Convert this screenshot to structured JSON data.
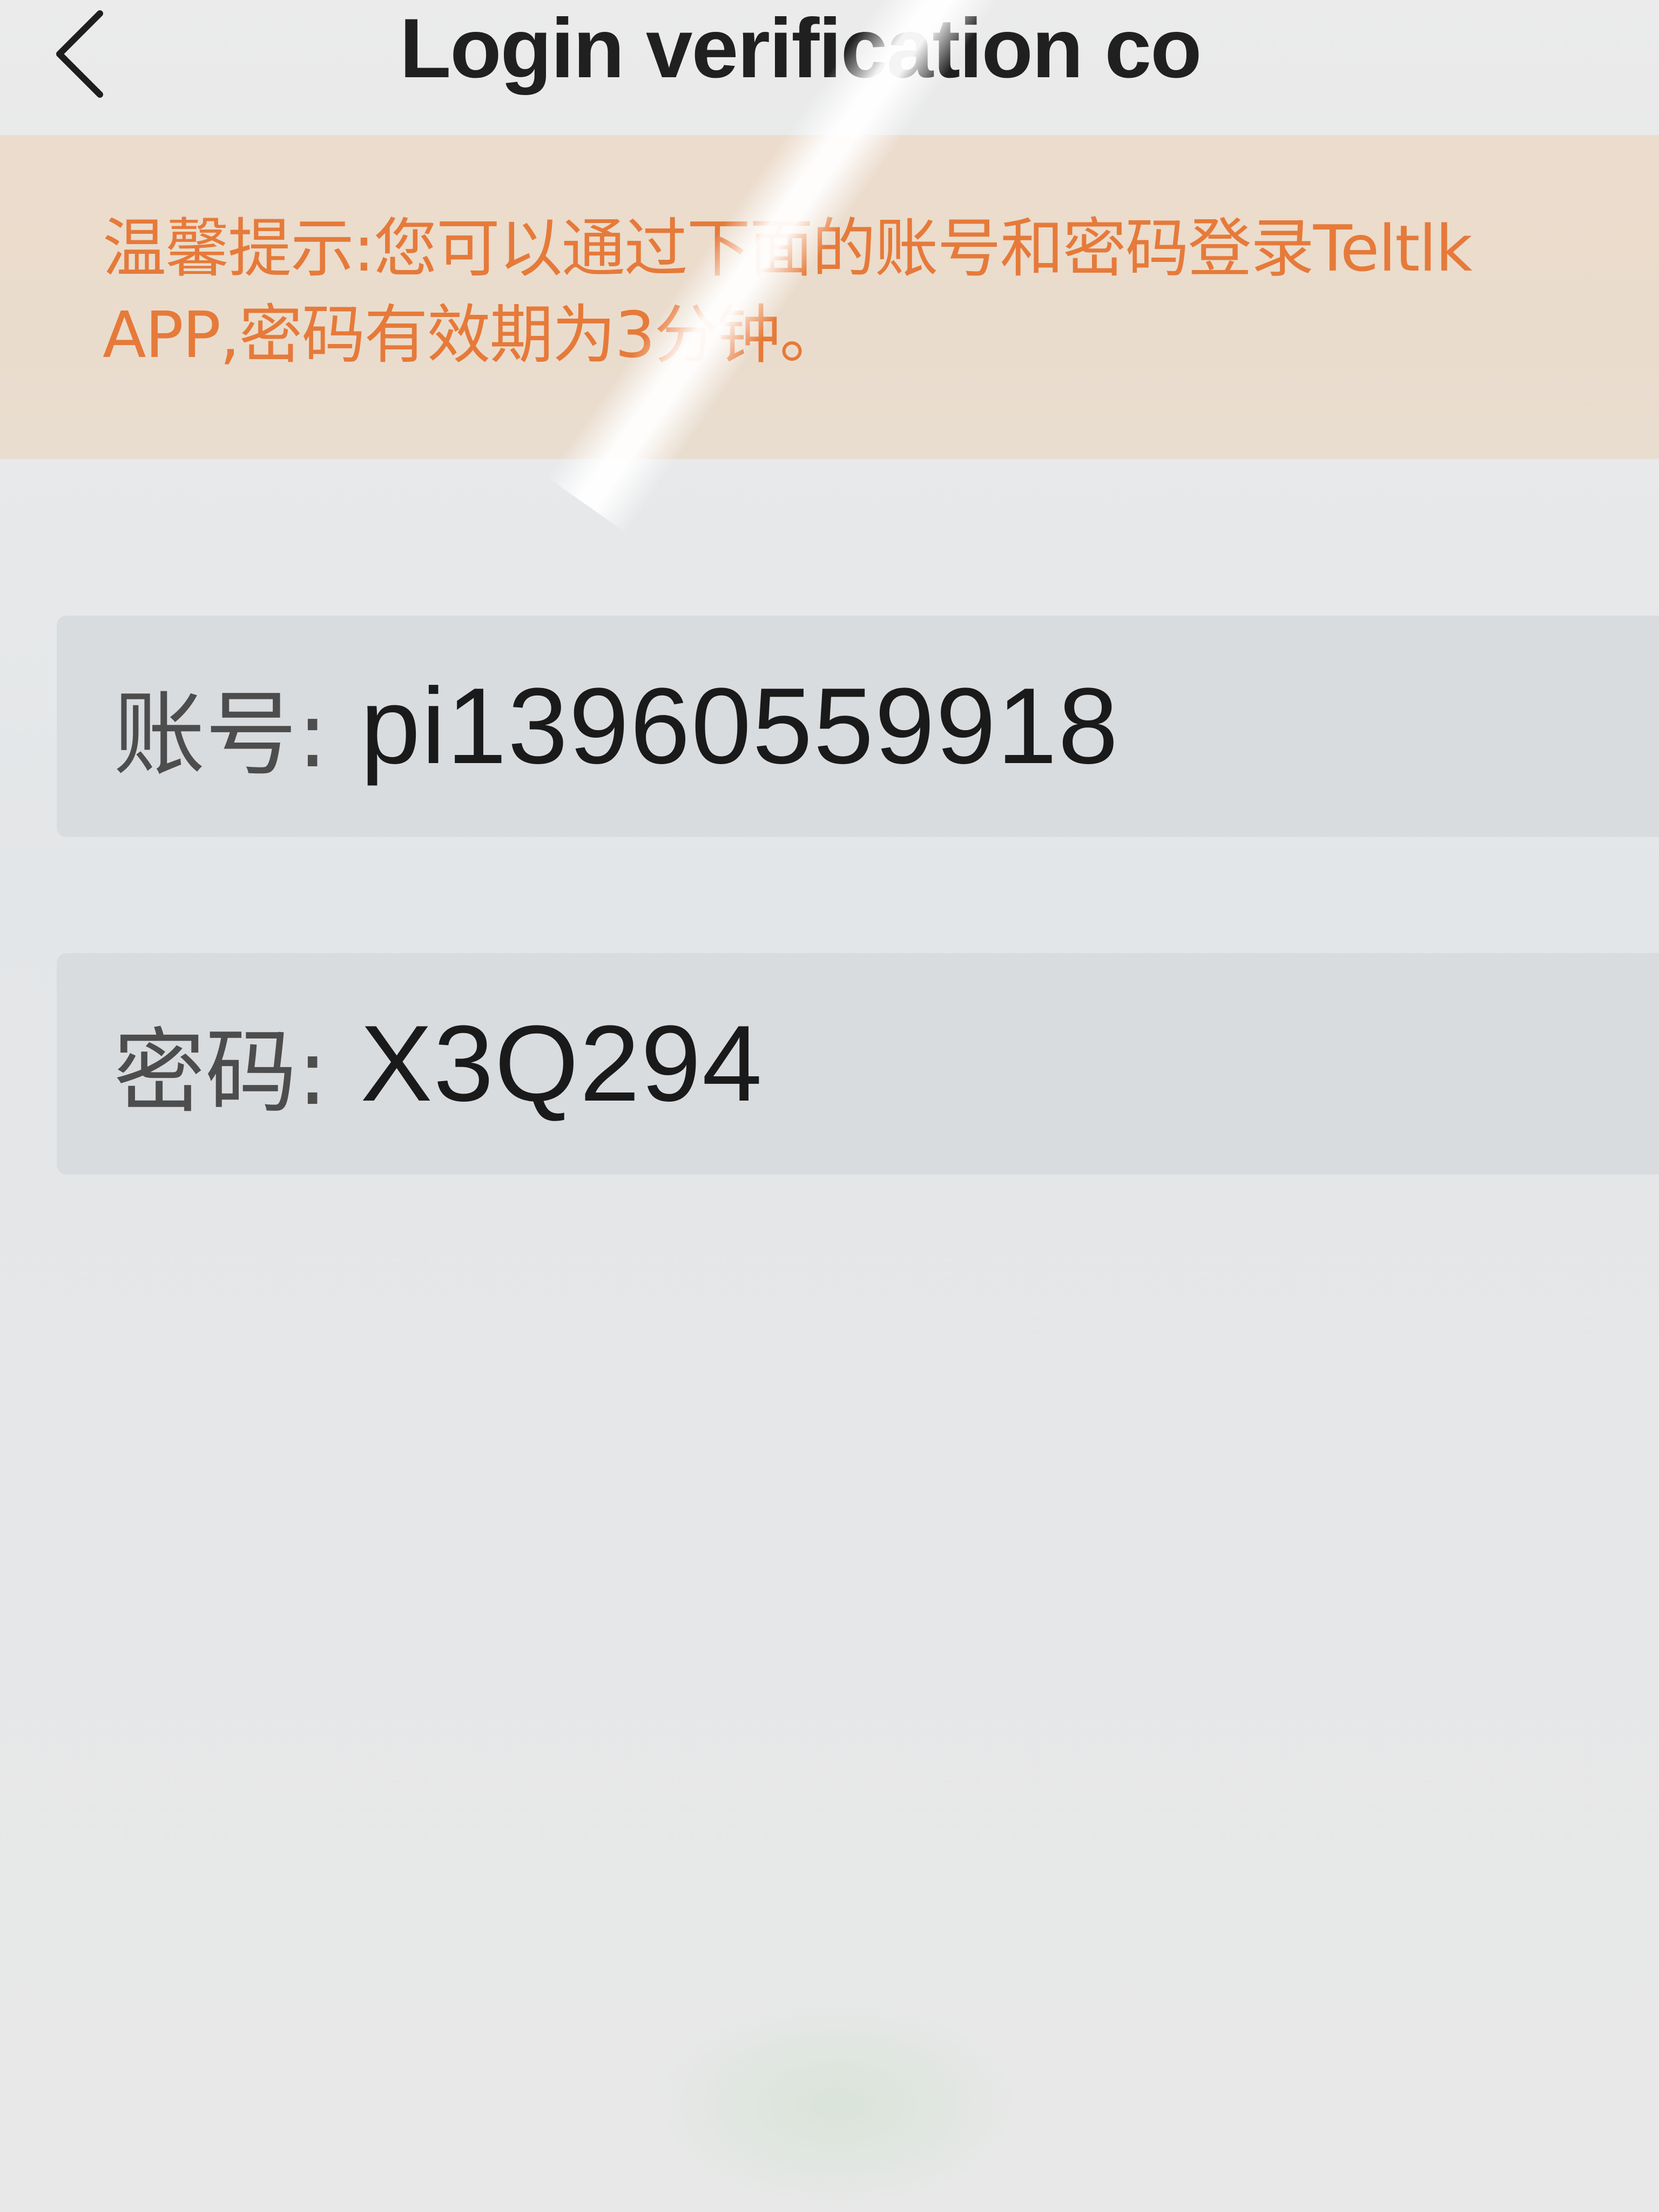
{
  "header": {
    "title": "Login verification co",
    "back_icon": "chevron-left-icon"
  },
  "notice": {
    "text": "温馨提示:您可以通过下面的账号和密码登录Teltlk APP,密码有效期为3分钟。",
    "color": "#e67a3a"
  },
  "account": {
    "label": "账号:",
    "value": "pi13960559918"
  },
  "password": {
    "label": "密码:",
    "value": "X3Q294"
  }
}
